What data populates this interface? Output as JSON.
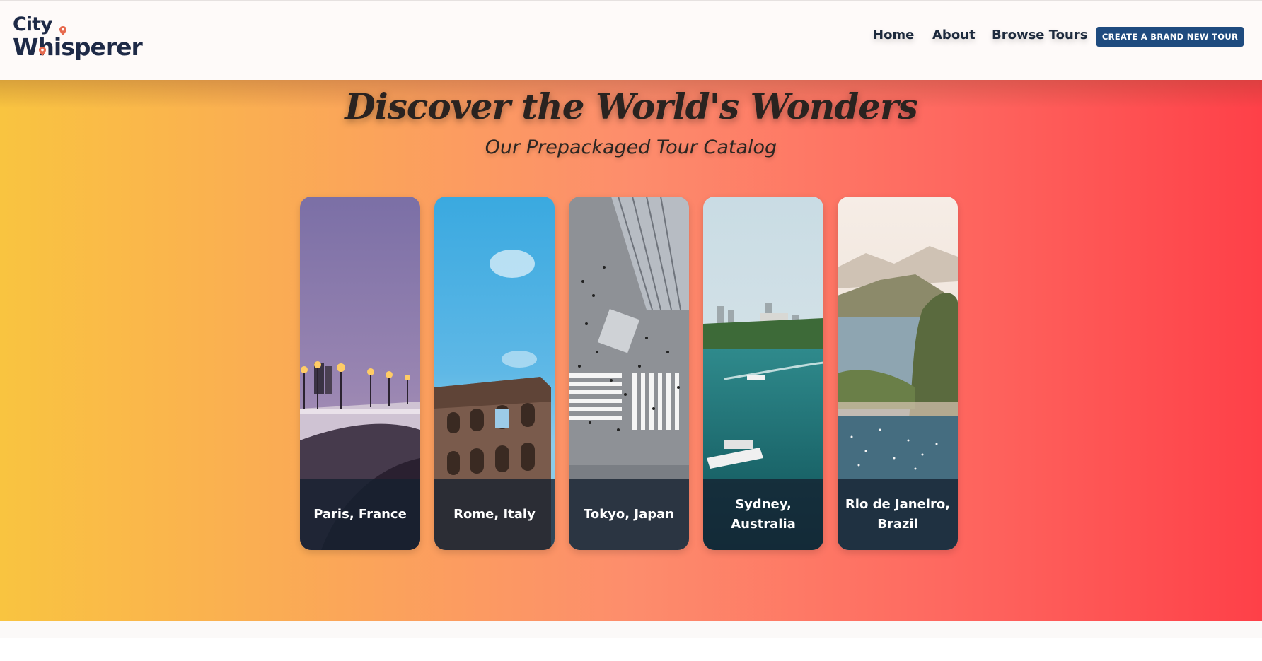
{
  "brand": {
    "line1": "City",
    "line2": "Whisperer",
    "color": "#1e2a47",
    "pin_color": "#e76a4f"
  },
  "nav": {
    "items": [
      {
        "label": "Home"
      },
      {
        "label": "About"
      },
      {
        "label": "Browse Tours"
      }
    ],
    "cta_label": "CREATE A BRAND NEW TOUR",
    "cta_color": "#1f4b7f"
  },
  "hero": {
    "title": "Discover the World's Wonders",
    "subtitle": "Our Prepackaged Tour Catalog",
    "gradient": [
      "#f9c440",
      "#fe4048"
    ]
  },
  "tours": [
    {
      "name": "Paris, France",
      "image": "paris-bridge-dusk-photo"
    },
    {
      "name": "Rome, Italy",
      "image": "rome-colosseum-photo"
    },
    {
      "name": "Tokyo, Japan",
      "image": "tokyo-crossing-photo"
    },
    {
      "name": "Sydney, Australia",
      "image": "sydney-harbour-photo"
    },
    {
      "name": "Rio de Janeiro, Brazil",
      "image": "rio-bay-photo"
    }
  ]
}
